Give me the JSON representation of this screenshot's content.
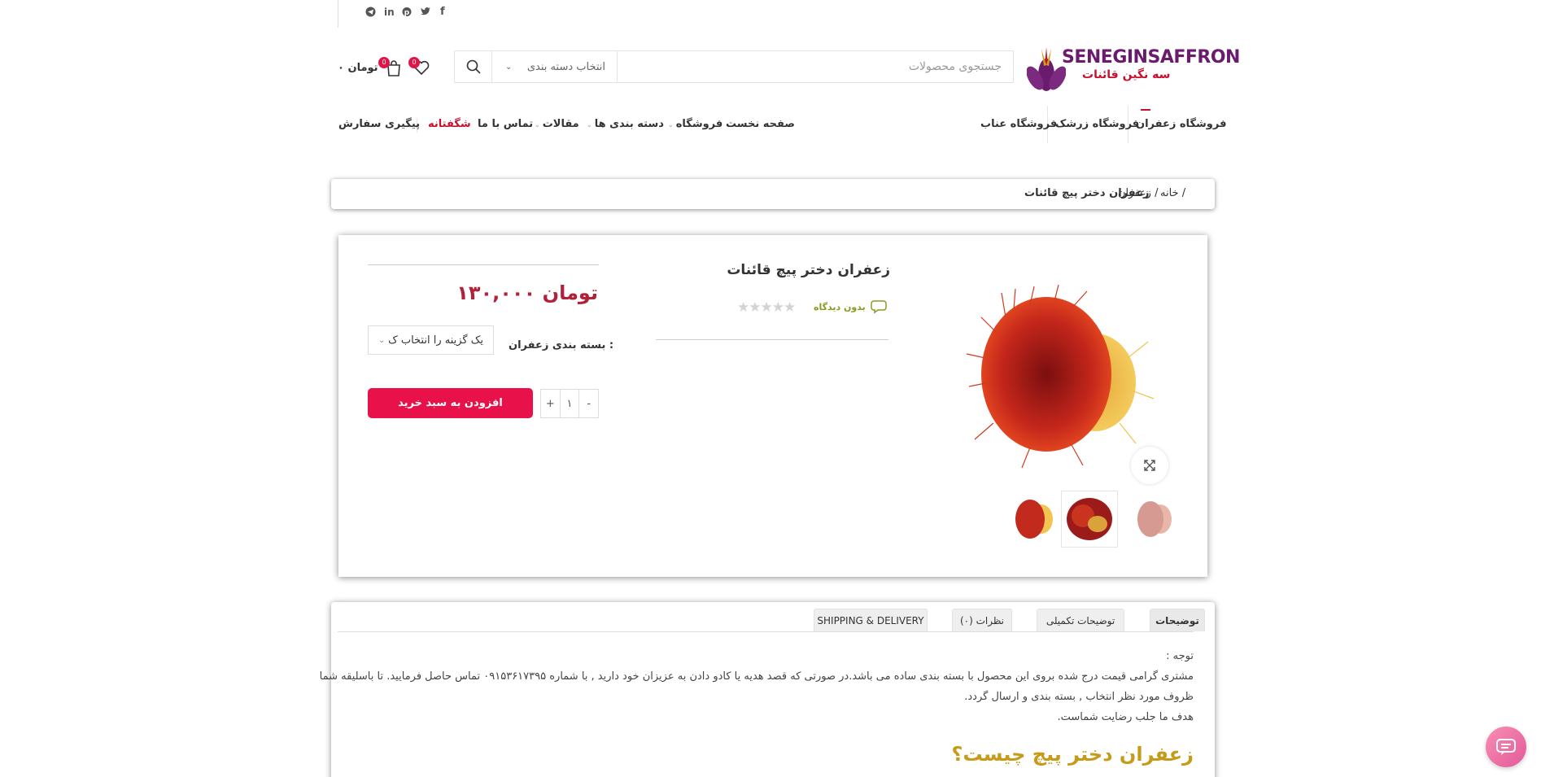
{
  "social": [
    "telegram-icon",
    "linkedin-icon",
    "pinterest-icon",
    "twitter-icon",
    "facebook-icon"
  ],
  "logo": {
    "brand": "SENEGINSAFFRON",
    "sub": "سه نگین قائنات"
  },
  "search": {
    "placeholder": "جستجوی محصولات",
    "category": "انتخاب دسته بندی"
  },
  "header": {
    "cart_total": "۰ تومان",
    "cart_count": "0",
    "wishlist_count": "0"
  },
  "top_links": [
    "فروشگاه زعفران",
    "فروشگاه زرشک",
    "فروشگاه عناب"
  ],
  "nav": {
    "home": "صفحه نخست",
    "shop": "فروشگاه",
    "categories": "دسته بندی ها",
    "articles": "مقالات",
    "contact": "تماس با ما",
    "amazing": "شگفتانه",
    "track": "پیگیری سفارش"
  },
  "breadcrumb": {
    "home": "خانه /",
    "cat": "زعفران /",
    "current": "زعفران دختر پیچ قائنات"
  },
  "product": {
    "title": "زعفران دختر پیچ قائنات",
    "reviews": "بدون دیدگاه",
    "stars": "★★★★★",
    "price": "۱۳۰,۰۰۰ تومان",
    "variation_label": "بسته بندی زعفران :",
    "variation_select": "یک گزینه را انتخاب ک",
    "qty_minus": "-",
    "qty_value": "۱",
    "qty_plus": "+",
    "add_to_cart": "افزودن به سبد خرید"
  },
  "tabs": [
    "توضیحات",
    "توضیحات تکمیلی",
    "نظرات (۰)",
    "SHIPPING & DELIVERY"
  ],
  "description": {
    "note": "توجه :",
    "line1": "مشتری گرامی قیمت درج شده بروی این محصول با بسته بندی ساده می باشد.در صورتی که قصد هدیه یا کادو دادن به عزیزان خود دارید , با شماره ۰۹۱۵۳۶۱۷۳۹۵ تماس حاصل فرمایید. تا باسلیقه شما",
    "line2": "ظروف مورد نظر انتخاب , بسته بندی و ارسال گردد.",
    "line3": "هدف ما جلب رضایت شماست.",
    "heading": "زعفران دختر پیچ چیست؟"
  },
  "colors": {
    "accent": "#e8114a",
    "price": "#b1223a",
    "heading": "#c79b1a",
    "brand": "#6a1b6e"
  }
}
